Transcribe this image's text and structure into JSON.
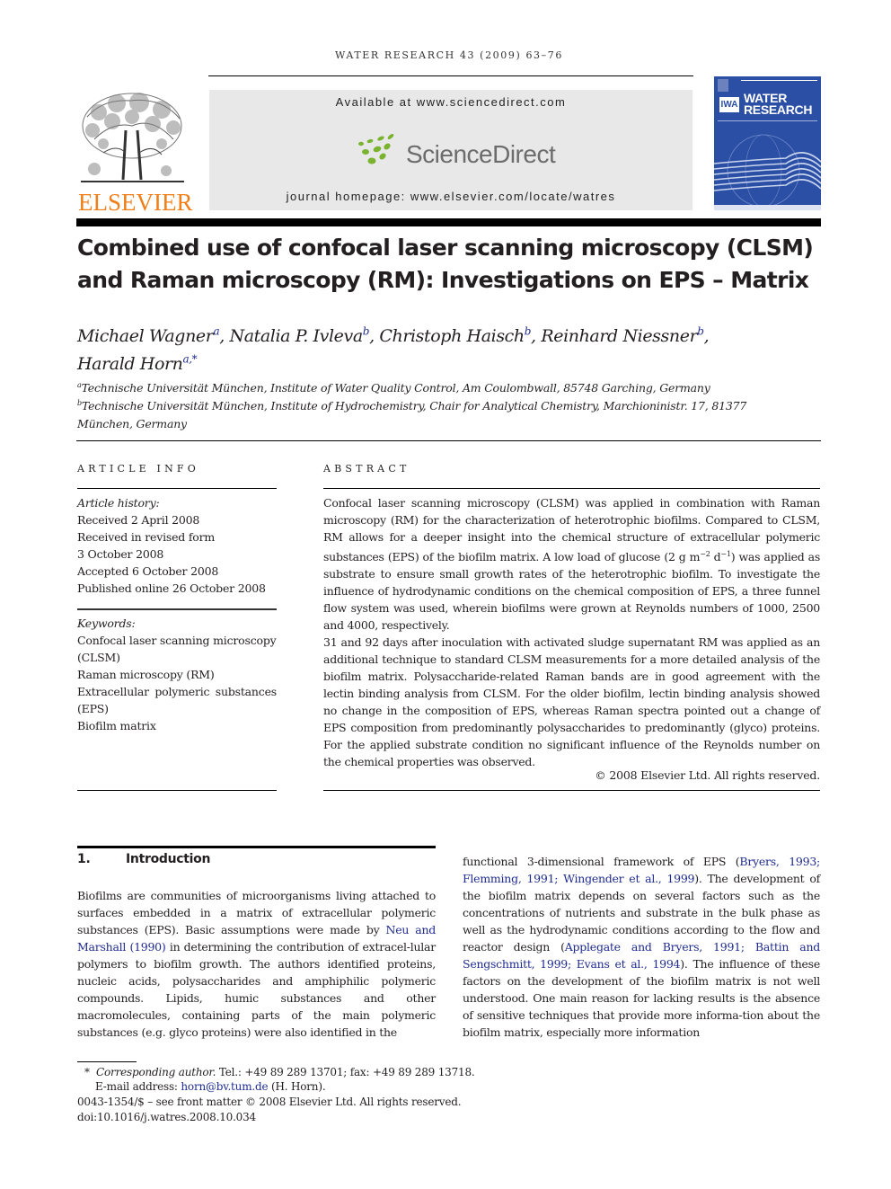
{
  "running_head": "WATER RESEARCH 43 (2009) 63–76",
  "masthead": {
    "publisher_logo": "ELSEVIER",
    "publisher_logo_icon": "tree-icon",
    "available_at": "Available at www.sciencedirect.com",
    "sciencedirect_logo_text": "ScienceDirect",
    "sciencedirect_logo_icon": "leaf-dots-icon",
    "journal_homepage": "journal homepage: www.elsevier.com/locate/watres",
    "journal_cover": {
      "title_line1": "WATER",
      "title_line2": "RESEARCH",
      "badge": "IWA",
      "background": "#2b4fa5"
    },
    "colors": {
      "elsevier_orange": "#f07f1a",
      "sd_green": "#7ab32e",
      "sd_gray": "#6c6c6c",
      "box_bg": "#e8e8e8",
      "link_blue": "#1f2c8f"
    }
  },
  "title": {
    "line1": "Combined use of confocal laser scanning microscopy (CLSM)",
    "line2": "and Raman microscopy (RM): Investigations on EPS – Matrix"
  },
  "authors": [
    {
      "name": "Michael Wagner",
      "sup": "a",
      "sep": ", "
    },
    {
      "name": "Natalia P. Ivleva",
      "sup": "b",
      "sep": ", "
    },
    {
      "name": "Christoph Haisch",
      "sup": "b",
      "sep": ", "
    },
    {
      "name": "Reinhard Niessner",
      "sup": "b",
      "sep": ","
    },
    {
      "name": "Harald Horn",
      "sup": "a,*",
      "sep": ""
    }
  ],
  "affiliations": [
    {
      "mark": "a",
      "text": "Technische Universität München, Institute of Water Quality Control, Am Coulombwall, 85748 Garching, Germany"
    },
    {
      "mark": "b",
      "text": "Technische Universität München, Institute of Hydrochemistry, Chair for Analytical Chemistry, Marchioninistr. 17, 81377",
      "cont": "München, Germany"
    }
  ],
  "article_info": {
    "heading": "ARTICLE INFO",
    "history_label": "Article history:",
    "history": [
      "Received 2 April 2008",
      "Received in revised form",
      "3 October 2008",
      "Accepted 6 October 2008",
      "Published online 26 October 2008"
    ],
    "keywords_label": "Keywords:",
    "keywords": [
      "Confocal laser scanning microscopy",
      "(CLSM)",
      "Raman microscopy (RM)",
      "Extracellular polymeric substances",
      "(EPS)",
      "Biofilm matrix"
    ]
  },
  "abstract": {
    "heading": "ABSTRACT",
    "p1_a": "Confocal laser scanning microscopy (CLSM) was applied in combination with Raman microscopy (RM) for the characterization of heterotrophic biofilms. Compared to CLSM, RM allows for a deeper insight into the chemical structure of extracellular polymeric substances (EPS) of the biofilm matrix. A low load of glucose (2 g m",
    "p1_sup1": "−2",
    "p1_mid": " d",
    "p1_sup2": "−1",
    "p1_b": ") was applied as substrate to ensure small growth rates of the heterotrophic biofilm. To investigate the influence of hydrodynamic conditions on the chemical composition of EPS, a three funnel flow system was used, wherein biofilms were grown at Reynolds numbers of 1000, 2500 and 4000, respectively.",
    "p2": "31 and 92 days after inoculation with activated sludge supernatant RM was applied as an additional technique to standard CLSM measurements for a more detailed analysis of the biofilm matrix. Polysaccharide-related Raman bands are in good agreement with the lectin binding analysis from CLSM. For the older biofilm, lectin binding analysis showed no change in the composition of EPS, whereas Raman spectra pointed out a change of EPS composition from predominantly polysaccharides to predominantly (glyco) proteins. For the applied substrate condition no significant influence of the Reynolds number on the chemical properties was observed.",
    "copyright": "© 2008 Elsevier Ltd. All rights reserved."
  },
  "introduction": {
    "number": "1.",
    "heading": "Introduction",
    "left": {
      "t1": "Biofilms are communities of microorganisms living attached to surfaces embedded in a matrix of extracellular polymeric substances (EPS). Basic assumptions were made by ",
      "link1": "Neu and Marshall (1990)",
      "t2": " in determining the contribution of extracel-lular polymers to biofilm growth. The authors identified proteins, nucleic acids, polysaccharides and amphiphilic polymeric compounds. Lipids, humic substances and other macromolecules, containing parts of the main polymeric substances (e.g. glyco proteins) were also identified in the"
    },
    "right": {
      "t1": "functional 3-dimensional framework of EPS (",
      "link1": "Bryers, 1993; Flemming, 1991; Wingender et al., 1999",
      "t2": "). The development of the biofilm matrix depends on several factors such as the concentrations of nutrients and substrate in the bulk phase as well as the hydrodynamic conditions according to the flow and reactor design (",
      "link2": "Applegate and Bryers, 1991; Battin and Sengschmitt, 1999; Evans et al., 1994",
      "t3": "). The influence of these factors on the development of the biofilm matrix is not well understood. One main reason for lacking results is the absence of sensitive techniques that provide more informa-tion about the biofilm matrix, especially more information"
    }
  },
  "footnotes": {
    "star": "*",
    "corresponding_label": "Corresponding author.",
    "contact": " Tel.: +49 89 289 13701; fax: +49 89 289 13718.",
    "email_label": "E-mail address: ",
    "email": "horn@bv.tum.de",
    "email_suffix": " (H. Horn).",
    "issn": "0043-1354/$ – see front matter © 2008 Elsevier Ltd. All rights reserved.",
    "doi": "doi:10.1016/j.watres.2008.10.034"
  }
}
